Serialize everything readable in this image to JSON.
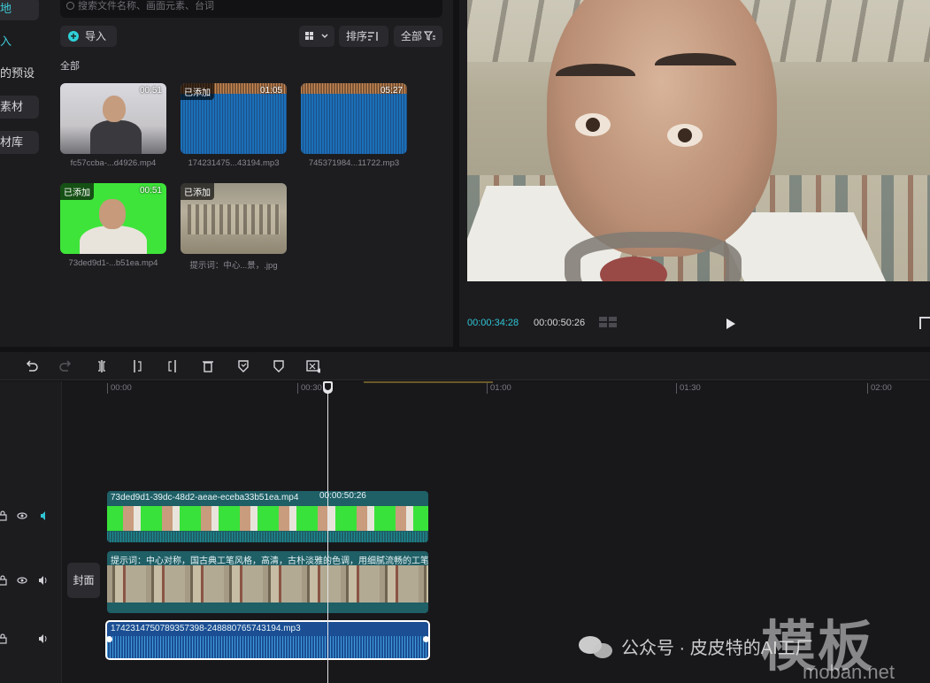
{
  "left_nav": {
    "items": [
      {
        "label": "地",
        "active": true
      },
      {
        "label": "入",
        "active": true
      },
      {
        "label": "的预设",
        "active": false
      },
      {
        "label": "素材",
        "active": false
      },
      {
        "label": "材库",
        "active": false
      }
    ]
  },
  "media": {
    "search_placeholder": "搜索文件名称、画面元素、台词",
    "import_label": "导入",
    "sort_label": "排序",
    "filter_label": "全部",
    "section_label": "全部",
    "items": [
      {
        "added": "",
        "duration": "00:51",
        "caption": "fc57ccba-...d4926.mp4",
        "kind": "person"
      },
      {
        "added": "已添加",
        "duration": "01:05",
        "caption": "174231475...43194.mp3",
        "kind": "audio"
      },
      {
        "added": "",
        "duration": "05:27",
        "caption": "745371984...11722.mp3",
        "kind": "audio"
      },
      {
        "added": "已添加",
        "duration": "00:51",
        "caption": "73ded9d1-...b51ea.mp4",
        "kind": "green"
      },
      {
        "added": "已添加",
        "duration": "",
        "caption": "提示词：中心...景，.jpg",
        "kind": "painting"
      }
    ]
  },
  "preview": {
    "current_time": "00:00:34:28",
    "total_time": "00:00:50:26"
  },
  "timeline": {
    "ruler": [
      "00:00",
      "00:30",
      "01:00",
      "01:30",
      "02:00"
    ],
    "cover_label": "封面",
    "clips": {
      "video": {
        "name": "73ded9d1-39dc-48d2-aeae-eceba33b51ea.mp4",
        "duration": "00:00:50:26"
      },
      "image": {
        "name": "提示词：中心对称，国古典工笔风格，高清，古朴淡雅的色调，用细腻流畅的工笔"
      },
      "audio": {
        "name": "1742314750789357398-248880765743194.mp3"
      }
    }
  },
  "watermark": {
    "account": "公众号 · 皮皮特的AI工厂",
    "brand": "模板",
    "site": "moban.net"
  },
  "colors": {
    "accent": "#2fc6d4",
    "green_screen": "#3ee43a",
    "audio_clip": "#1b4e93",
    "video_clip": "#1f5f66"
  }
}
